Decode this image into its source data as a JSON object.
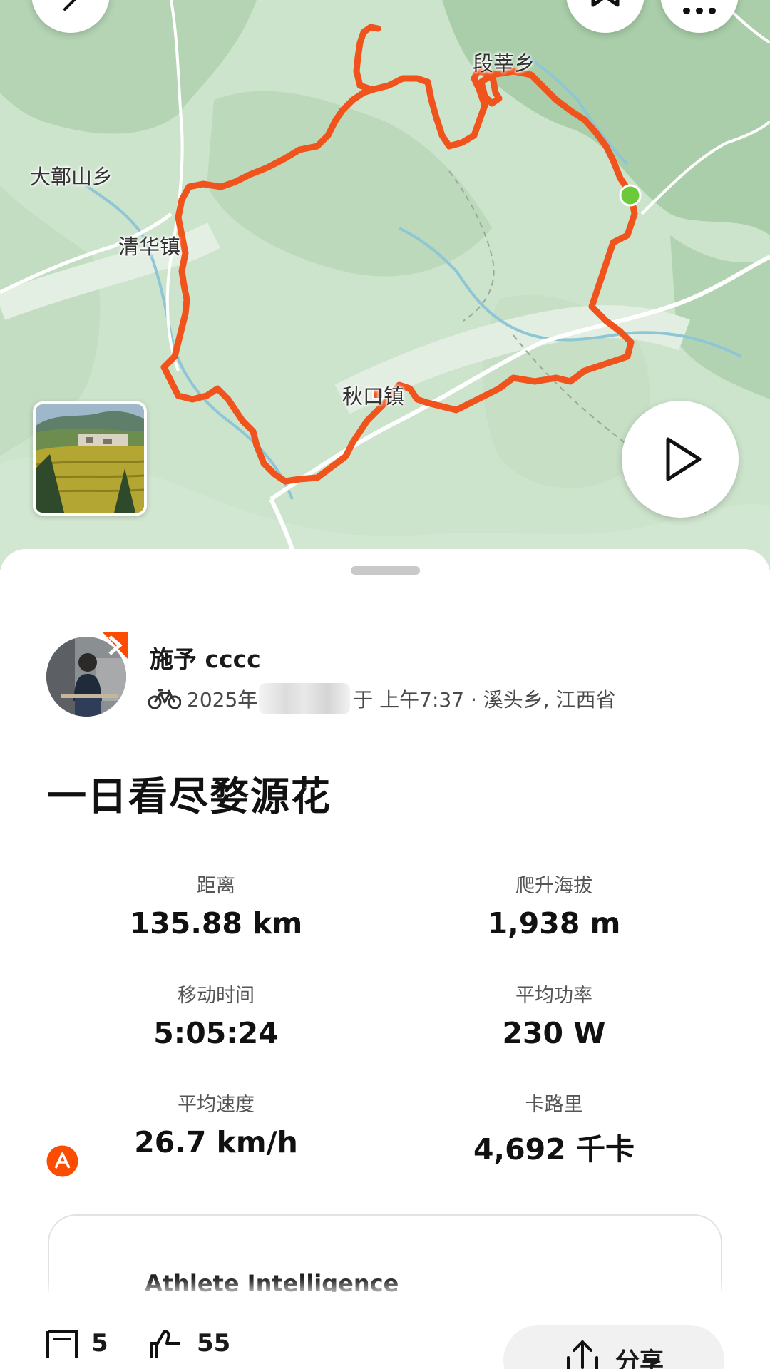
{
  "map": {
    "places": [
      {
        "id": "duanxin",
        "label": "段莘乡"
      },
      {
        "id": "daguoshan",
        "label": "大鄣山乡"
      },
      {
        "id": "qinghua",
        "label": "清华镇"
      },
      {
        "id": "qiukou",
        "label": "秋口镇"
      }
    ],
    "route_color": "#f0531c",
    "start_marker_color": "#6cc93a",
    "buttons": {
      "back_icon": "chevron-left-icon",
      "bookmark_icon": "bookmark-icon",
      "more_icon": "more-icon",
      "play_icon": "play-icon"
    }
  },
  "athlete": {
    "name": "施予 cccc",
    "date_prefix": "2025年",
    "time_location": "于 上午7:37 · 溪头乡, 江西省",
    "badge_color": "#fc4c02",
    "sport_icon": "bike-icon"
  },
  "activity": {
    "title": "一日看尽婺源花",
    "stats": [
      {
        "label": "距离",
        "value": "135.88 km"
      },
      {
        "label": "爬升海拔",
        "value": "1,938 m"
      },
      {
        "label": "移动时间",
        "value": "5:05:24"
      },
      {
        "label": "平均功率",
        "value": "230 W"
      },
      {
        "label": "平均速度",
        "value": "26.7 km/h"
      },
      {
        "label": "卡路里",
        "value": "4,692 千卡"
      }
    ]
  },
  "insights": {
    "title": "Athlete Intelligence",
    "accent": "#fc4c02"
  },
  "bottom_bar": {
    "comments_count": "5",
    "kudos_count": "55",
    "share_label": "分享"
  }
}
